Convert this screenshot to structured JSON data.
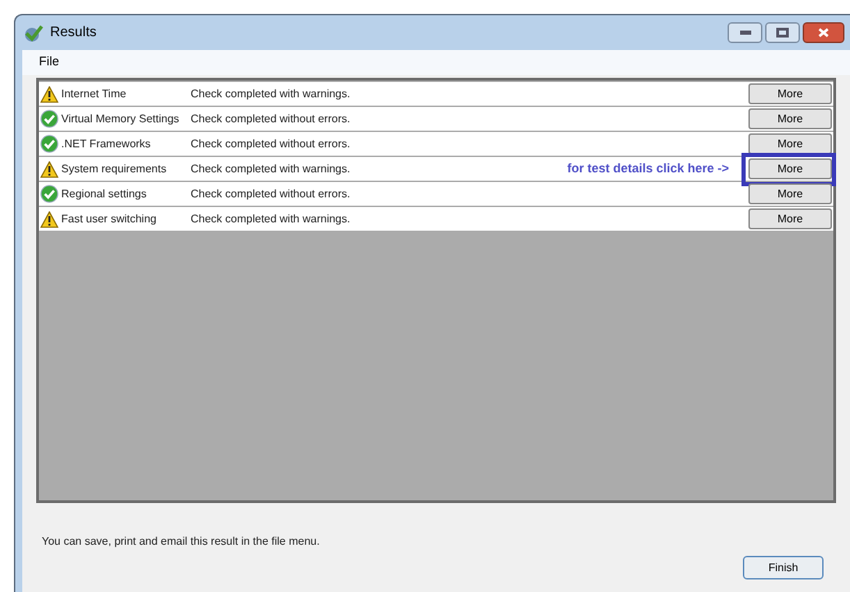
{
  "window": {
    "title": "Results"
  },
  "menu": [
    "File"
  ],
  "results": [
    {
      "name": "Internet Time",
      "kind": "warning",
      "message": "Check completed with warnings.",
      "button": "More"
    },
    {
      "name": "Virtual Memory Settings",
      "kind": "ok",
      "message": "Check completed without errors.",
      "button": "More"
    },
    {
      "name": ".NET Frameworks",
      "kind": "ok",
      "message": "Check completed without errors.",
      "button": "More"
    },
    {
      "name": "System requirements",
      "kind": "warning",
      "message": "Check completed with warnings.",
      "button": "More",
      "annotation": "for test details click here ->"
    },
    {
      "name": "Regional settings",
      "kind": "ok",
      "message": "Check completed without errors.",
      "button": "More"
    },
    {
      "name": "Fast user switching",
      "kind": "warning",
      "message": "Check completed with warnings.",
      "button": "More"
    }
  ],
  "footer_note": "You can save, print and email this result in the file menu.",
  "finish_button": "Finish"
}
